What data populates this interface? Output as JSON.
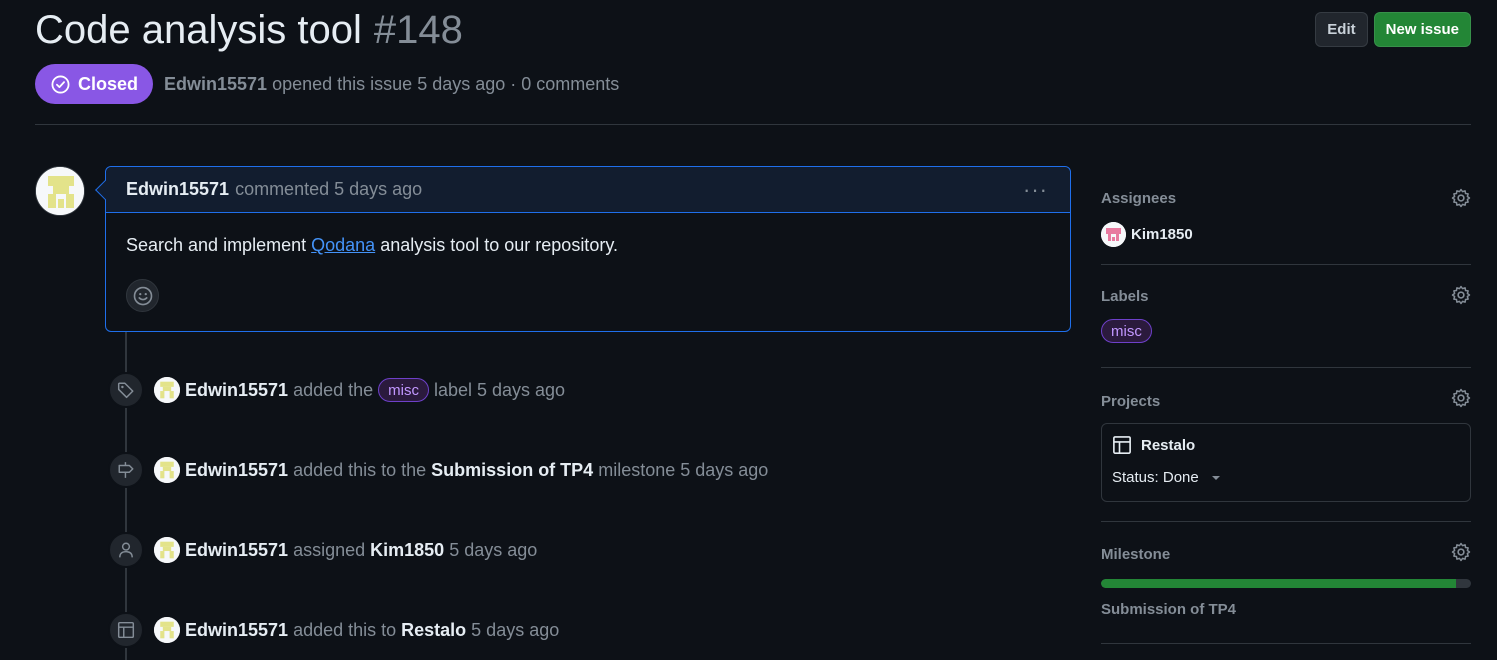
{
  "issue": {
    "title": "Code analysis tool",
    "number": "#148",
    "state": "Closed",
    "author": "Edwin15571",
    "opened_text": "opened this issue 5 days ago · 0 comments"
  },
  "header": {
    "edit_label": "Edit",
    "new_issue_label": "New issue"
  },
  "comment": {
    "author": "Edwin15571",
    "action": "commented 5 days ago",
    "body_before": "Search and implement",
    "link_text": "Qodana",
    "body_after": "analysis tool to our repository.",
    "menu_glyph": "···"
  },
  "timeline": [
    {
      "icon": "tag-icon",
      "actor": "Edwin15571",
      "pre": "added the",
      "label": "misc",
      "post": "label 5 days ago"
    },
    {
      "icon": "milestone-icon",
      "actor": "Edwin15571",
      "pre": "added this to the",
      "target": "Submission of TP4",
      "post": "milestone 5 days ago"
    },
    {
      "icon": "person-icon",
      "actor": "Edwin15571",
      "pre": "assigned",
      "target": "Kim1850",
      "post": "5 days ago"
    },
    {
      "icon": "table-icon",
      "actor": "Edwin15571",
      "pre": "added this to",
      "target": "Restalo",
      "post": "5 days ago"
    }
  ],
  "sidebar": {
    "assignees_title": "Assignees",
    "assignee": "Kim1850",
    "labels_title": "Labels",
    "label": "misc",
    "projects_title": "Projects",
    "project_name": "Restalo",
    "project_status": "Status: Done",
    "milestone_title": "Milestone",
    "milestone_name": "Submission of TP4",
    "milestone_progress": 0.96
  },
  "colors": {
    "closed_purple": "#8957e5",
    "new_issue_green": "#238636",
    "link_blue": "#4493f8",
    "label_text": "#c297ff"
  }
}
